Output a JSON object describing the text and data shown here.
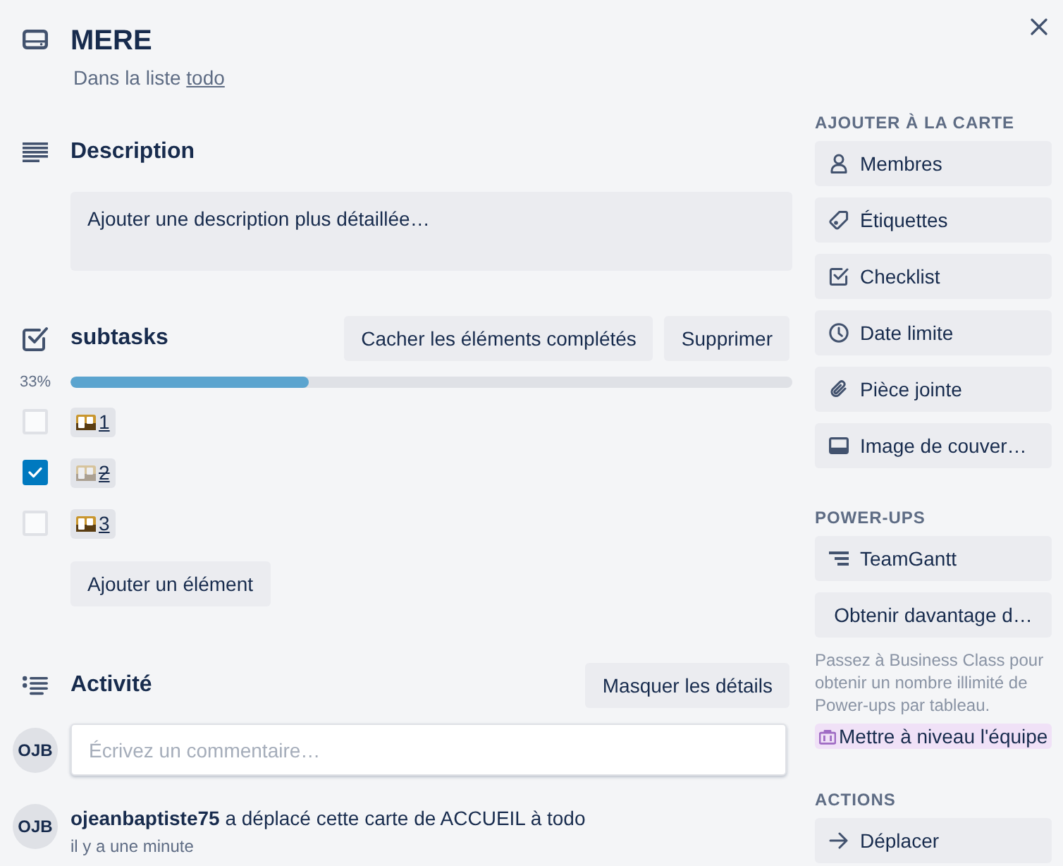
{
  "card": {
    "title": "MERE",
    "list_prefix": "Dans la liste",
    "list_name": "todo"
  },
  "description": {
    "heading": "Description",
    "prompt": "Ajouter une description plus détaillée…"
  },
  "checklist": {
    "title": "subtasks",
    "buttons": [
      "Cacher les éléments complétés",
      "Supprimer"
    ],
    "percent": "33%",
    "level": 0.33,
    "items": [
      {
        "label": "1",
        "checked": false
      },
      {
        "label": "2",
        "checked": true
      },
      {
        "label": "3",
        "checked": false
      }
    ],
    "add_button": "Ajouter un élément"
  },
  "activity": {
    "heading": "Activité",
    "toggle_button": "Masquer les détails",
    "comment": {
      "avatar": "OJB",
      "placeholder": "Écrivez un commentaire…"
    },
    "entries": [
      {
        "avatar": "OJB",
        "text": "**ojeanbaptiste75** a déplacé cette carte de ACCUEIL à todo",
        "time": "il y a une minute"
      }
    ]
  },
  "sidebar": {
    "sections": [
      {
        "title": "AJOUTER À LA CARTE",
        "items": [
          {
            "kind": "action",
            "label": "Membres"
          },
          {
            "kind": "action",
            "label": "Étiquettes"
          },
          {
            "kind": "action",
            "label": "Checklist"
          },
          {
            "kind": "action",
            "label": "Date limite"
          },
          {
            "kind": "action",
            "label": "Pièce jointe"
          },
          {
            "kind": "action",
            "label": "Image de couver…"
          }
        ]
      },
      {
        "title": "POWER-UPS",
        "items": [
          {
            "kind": "power_up",
            "label": "TeamGantt"
          },
          {
            "kind": "more",
            "label": "Obtenir davantage d…"
          }
        ],
        "note": "Passez à Business Class pour obtenir un nombre illimité de Power-ups par tableau.",
        "upgrade": "Mettre à niveau l'équipe"
      },
      {
        "title": "ACTIONS",
        "items": [
          {
            "kind": "action",
            "label": "Déplacer"
          }
        ]
      }
    ]
  }
}
